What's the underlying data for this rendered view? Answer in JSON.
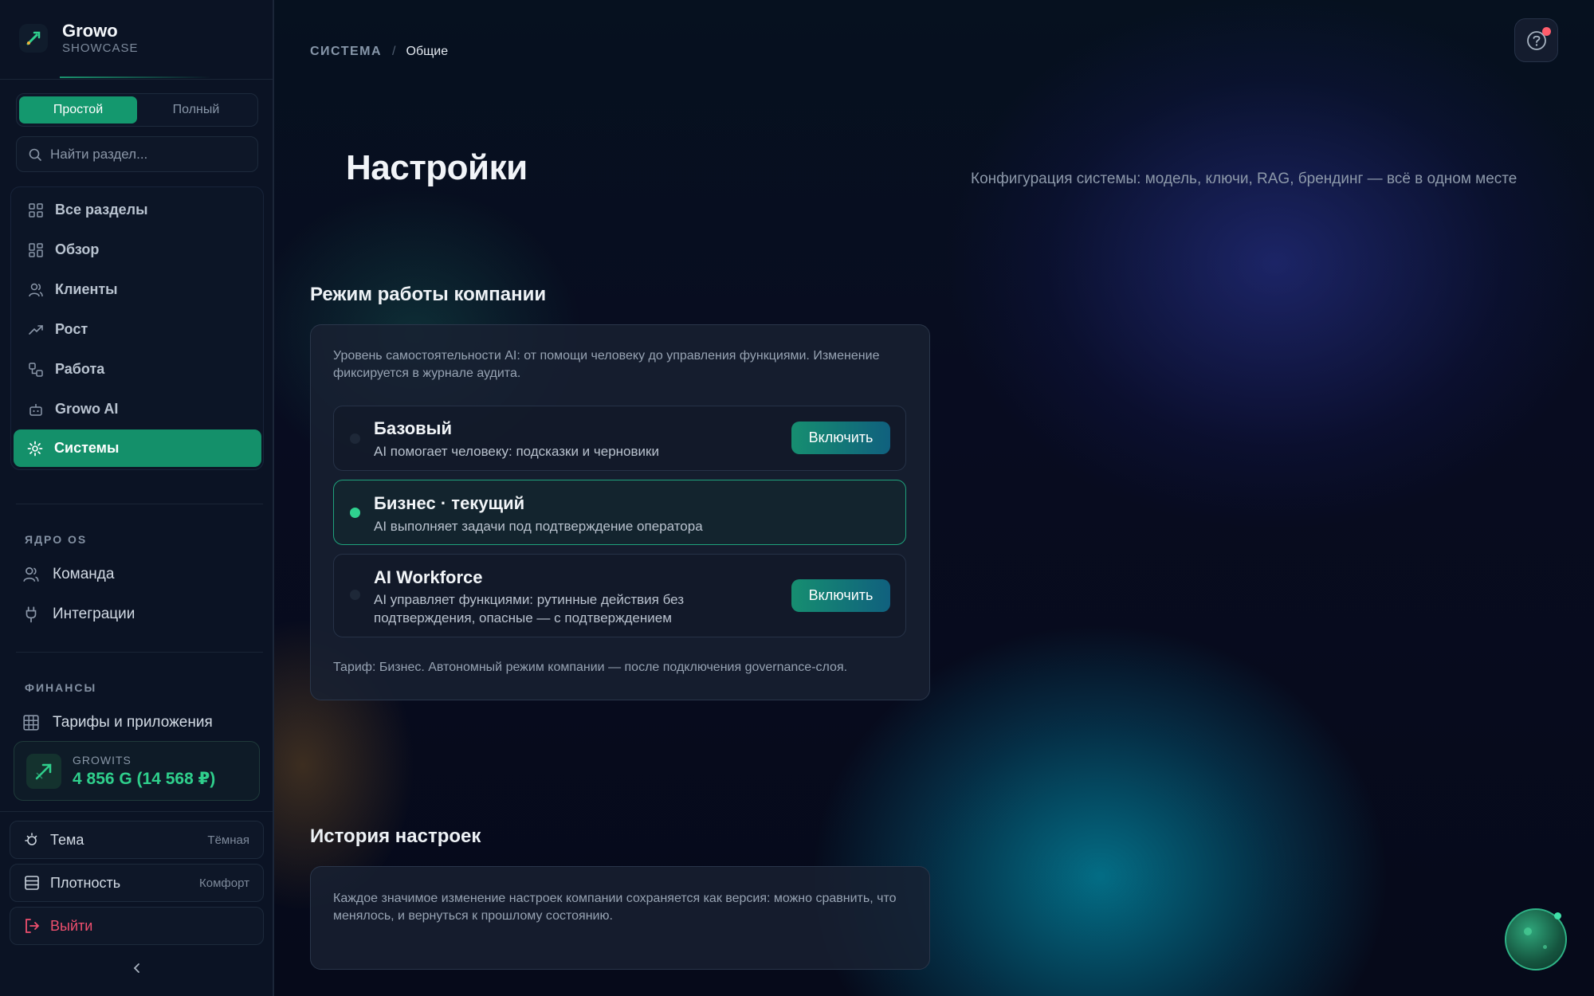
{
  "brand": {
    "name": "Growo",
    "subtitle": "SHOWCASE"
  },
  "mode_toggle": {
    "simple": "Простой",
    "full": "Полный",
    "active": "simple"
  },
  "search": {
    "placeholder": "Найти раздел..."
  },
  "nav": {
    "items": [
      {
        "label": "Все разделы",
        "icon": "grid-icon"
      },
      {
        "label": "Обзор",
        "icon": "dashboard-icon"
      },
      {
        "label": "Клиенты",
        "icon": "users-icon"
      },
      {
        "label": "Рост",
        "icon": "trending-up-icon"
      },
      {
        "label": "Работа",
        "icon": "workflow-icon"
      },
      {
        "label": "Growo AI",
        "icon": "bot-icon"
      },
      {
        "label": "Системы",
        "icon": "gear-icon",
        "active": true
      }
    ]
  },
  "core_os": {
    "label": "ЯДРО OS",
    "items": [
      {
        "label": "Команда",
        "icon": "users-icon"
      },
      {
        "label": "Интеграции",
        "icon": "plug-icon"
      }
    ]
  },
  "finance": {
    "label": "ФИНАНСЫ",
    "items": [
      {
        "label": "Тарифы и приложения",
        "icon": "table-icon"
      }
    ],
    "balance": {
      "label": "GROWITS",
      "value": "4 856 G (14 568 ₽)"
    }
  },
  "prefs": {
    "theme": {
      "label": "Тема",
      "value": "Тёмная"
    },
    "density": {
      "label": "Плотность",
      "value": "Комфорт"
    },
    "logout": {
      "label": "Выйти"
    }
  },
  "breadcrumb": {
    "root": "СИСТЕМА",
    "separator": "/",
    "current": "Общие"
  },
  "page": {
    "title": "Настройки",
    "subtitle": "Конфигурация системы: модель, ключи, RAG, брендинг — всё в одном месте"
  },
  "company_mode": {
    "title": "Режим работы компании",
    "description": "Уровень самостоятельности AI: от помощи человеку до управления функциями. Изменение фиксируется в журнале аудита.",
    "options": [
      {
        "title": "Базовый",
        "description": "AI помогает человеку: подсказки и черновики",
        "action": "Включить",
        "current": false
      },
      {
        "title": "Бизнес · текущий",
        "description": "AI выполняет задачи под подтверждение оператора",
        "current": true
      },
      {
        "title": "AI Workforce",
        "description": "AI управляет функциями: рутинные действия без подтверждения, опасные — с подтверждением",
        "action": "Включить",
        "current": false
      }
    ],
    "tariff_note": "Тариф: Бизнес. Автономный режим компании — после подключения governance-слоя."
  },
  "history": {
    "title": "История настроек",
    "description": "Каждое значимое изменение настроек компании сохраняется как версия: можно сравнить, что менялось, и вернуться к прошлому состоянию."
  },
  "colors": {
    "accent": "#14986e",
    "success": "#2fcf8c",
    "danger": "#ef4f6e",
    "notification": "#ff5d6c"
  }
}
